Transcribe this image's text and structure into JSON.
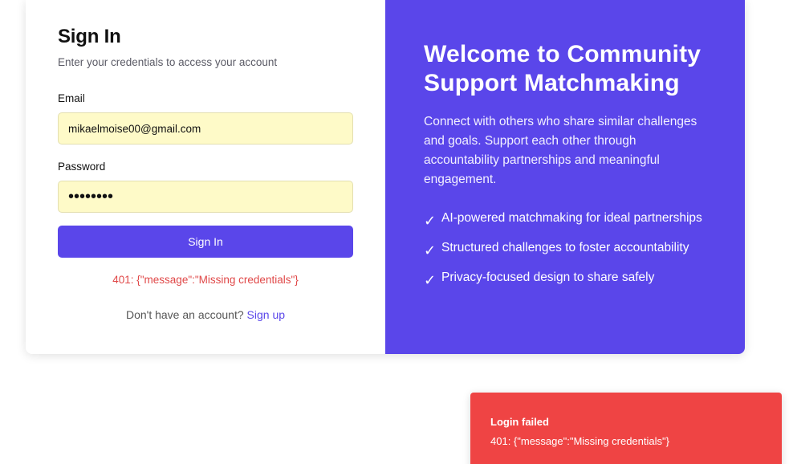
{
  "signin": {
    "title": "Sign In",
    "subtitle": "Enter your credentials to access your account",
    "email_label": "Email",
    "email_value": "mikaelmoise00@gmail.com",
    "password_label": "Password",
    "password_value": "password",
    "submit_label": "Sign In",
    "error_text": "401: {\"message\":\"Missing credentials\"}",
    "signup_prompt": "Don't have an account?",
    "signup_link": "Sign up"
  },
  "promo": {
    "heading": "Welcome to Community Support Matchmaking",
    "description": "Connect with others who share similar challenges and goals. Support each other through accountability partnerships and meaningful engagement.",
    "check_icon": "✓",
    "features": [
      "AI-powered matchmaking for ideal partnerships",
      "Structured challenges to foster accountability",
      "Privacy-focused design to share safely"
    ],
    "accent_color": "#5a46ea"
  },
  "toast": {
    "title": "Login failed",
    "message": "401: {\"message\":\"Missing credentials\"}",
    "color": "#ef4444"
  }
}
